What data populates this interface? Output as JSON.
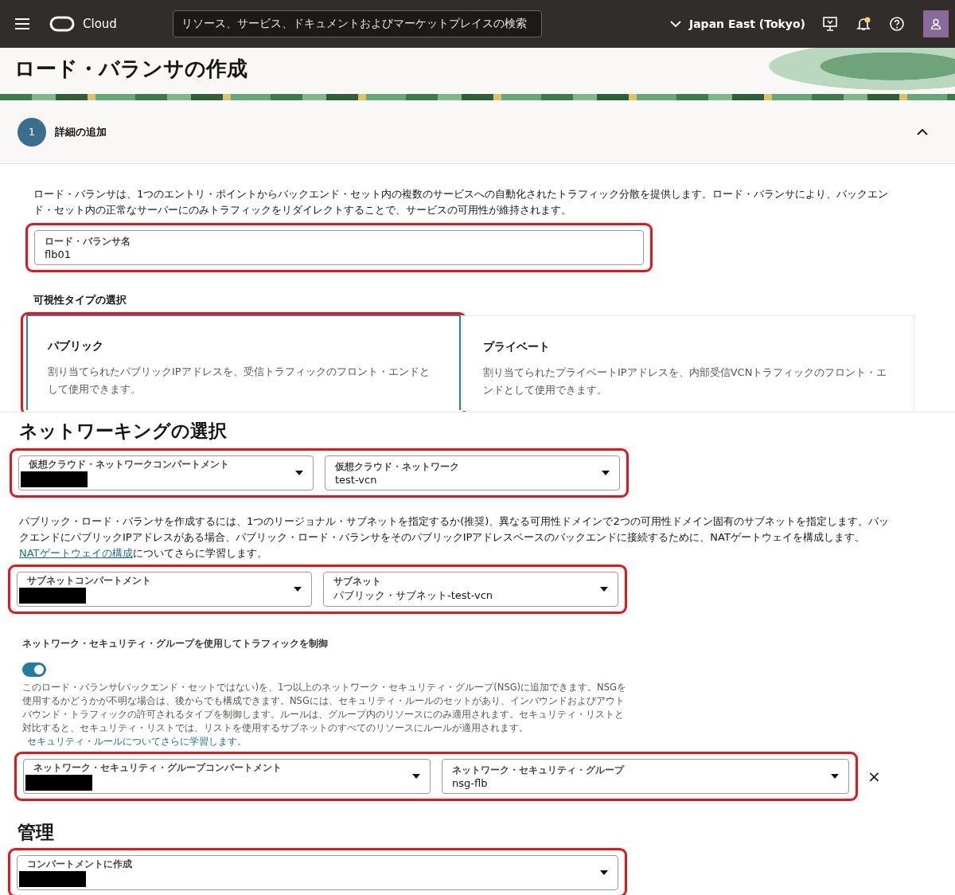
{
  "header": {
    "product": "Cloud",
    "search_placeholder": "リソース、サービス、ドキュメントおよびマーケットプレイスの検索",
    "region": "Japan East (Tokyo)",
    "notification": true
  },
  "page_title": "ロード・バランサの作成",
  "step": {
    "number": "1",
    "title": "詳細の追加",
    "expanded": true
  },
  "intro": "ロード・バランサは、1つのエントリ・ポイントからバックエンド・セット内の複数のサービスへの自動化されたトラフィック分散を提供します。ロード・バランサにより、バックエンド・セット内の正常なサーバーにのみトラフィックをリダイレクトすることで、サービスの可用性が維持されます。",
  "name_field": {
    "label": "ロード・バランサ名",
    "value": "flb01",
    "highlighted": true
  },
  "visibility": {
    "heading": "可視性タイプの選択",
    "highlighted": true,
    "options": [
      {
        "title": "パブリック",
        "description": "割り当てられたパブリックIPアドレスを、受信トラフィックのフロント・エンドとして使用できます。",
        "selected": true
      },
      {
        "title": "プライベート",
        "description": "割り当てられたプライベートIPアドレスを、内部受信VCNトラフィックのフロント・エンドとして使用できます。",
        "selected": false
      }
    ]
  },
  "networking": {
    "heading": "ネットワーキングの選択",
    "vcn_row": {
      "highlighted": true,
      "fields": [
        {
          "label": "仮想クラウド・ネットワークコンパートメント",
          "redacted": true
        },
        {
          "label": "仮想クラウド・ネットワーク",
          "value": "test-vcn",
          "redacted": false
        }
      ]
    },
    "subnet_note": {
      "text": "パブリック・ロード・バランサを作成するには、1つのリージョナル・サブネットを指定するか(推奨)、異なる可用性ドメインで2つの可用性ドメイン固有のサブネットを指定します。バックエンドにパブリックIPアドレスがある場合、パブリック・ロード・バランサをそのパブリックIPアドレスベースのバックエンドに接続するために、NATゲートウェイを構成します。",
      "link": "NATゲートウェイの構成",
      "after": "についてさらに学習します。"
    },
    "subnet_row": {
      "highlighted": true,
      "fields": [
        {
          "label": "サブネットコンパートメント",
          "redacted": true
        },
        {
          "label": "サブネット",
          "value": "パブリック・サブネット-test-vcn",
          "redacted": false
        }
      ]
    },
    "nsg_toggle": {
      "label": "ネットワーク・セキュリティ・グループを使用してトラフィックを制御",
      "on": true
    },
    "nsg_note": {
      "text": "このロード・バランサ(バックエンド・セットではない)を、1つ以上のネットワーク・セキュリティ・グループ(NSG)に追加できます。NSGを使用するかどうかが不明な場合は、後からでも構成できます。NSGには、セキュリティ・ルールのセットがあり、インバウンドおよびアウトバウンド・トラフィックの許可されるタイプを制御します。ルールは、グループ内のリソースにのみ適用されます。セキュリティ・リストと対比すると、セキュリティ・リストでは、リストを使用するサブネットのすべてのリソースにルールが適用されます。",
      "link": "セキュリティ・ルールについてさらに学習します。"
    },
    "nsg_row": {
      "highlighted": true,
      "remove": "×",
      "fields": [
        {
          "label": "ネットワーク・セキュリティ・グループコンパートメント",
          "redacted": true
        },
        {
          "label": "ネットワーク・セキュリティ・グループ",
          "value": "nsg-flb",
          "redacted": false
        }
      ]
    }
  },
  "management": {
    "heading": "管理",
    "row": {
      "highlighted": true,
      "fields": [
        {
          "label": "コンパートメントに作成",
          "redacted": true
        }
      ]
    }
  }
}
